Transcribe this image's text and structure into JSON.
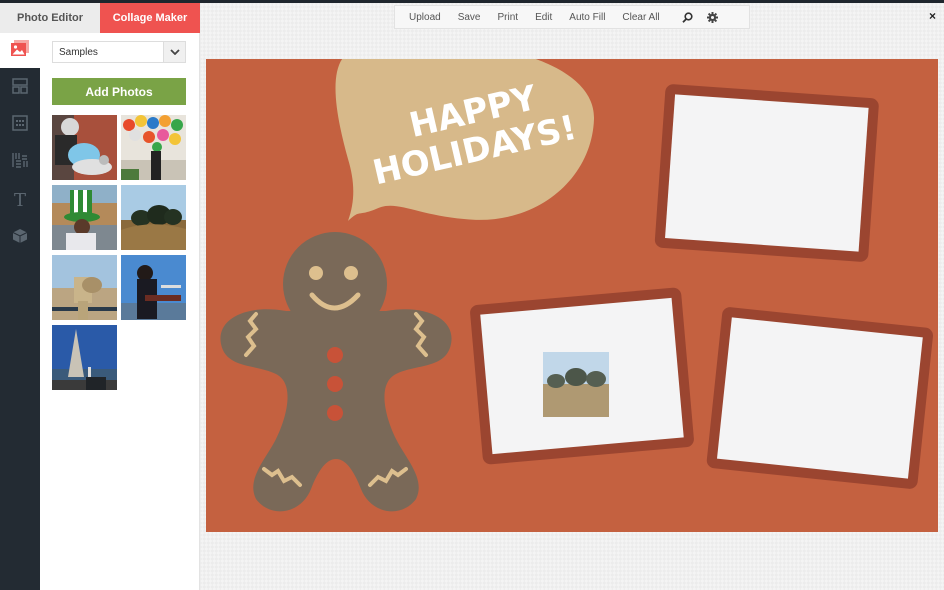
{
  "tabs": [
    {
      "label": "Photo Editor",
      "active": false
    },
    {
      "label": "Collage Maker",
      "active": true
    }
  ],
  "rail": {
    "items": [
      {
        "name": "photos",
        "icon": "image-icon",
        "active": true
      },
      {
        "name": "layouts",
        "icon": "layout-icon",
        "active": false
      },
      {
        "name": "grid",
        "icon": "grid-icon",
        "active": false
      },
      {
        "name": "backgrounds",
        "icon": "pattern-icon",
        "active": false
      },
      {
        "name": "text",
        "icon": "text-icon",
        "active": false
      },
      {
        "name": "stickers",
        "icon": "cube-icon",
        "active": false
      }
    ]
  },
  "panel": {
    "source_select": {
      "value": "Samples"
    },
    "add_photos_label": "Add Photos",
    "thumbnails": [
      {
        "subject": "scooter rider"
      },
      {
        "subject": "balloons woman"
      },
      {
        "subject": "green hat man"
      },
      {
        "subject": "trees on hill"
      },
      {
        "subject": "binocular viewer"
      },
      {
        "subject": "musician on pier"
      },
      {
        "subject": "transamerica tower"
      }
    ]
  },
  "toolbar": {
    "items": [
      "Upload",
      "Save",
      "Print",
      "Edit",
      "Auto Fill",
      "Clear All"
    ],
    "search_icon": "search-icon",
    "settings_icon": "gear-icon"
  },
  "close_label": "×",
  "canvas": {
    "bubble_text": [
      "HAPPY",
      "HOLIDAYS!"
    ],
    "colors": {
      "background": "#c46140",
      "bubble": "#d7b98a",
      "frame": "#9b4530",
      "frame_inner": "#f4f4f5",
      "gingerbread": "#7a6958",
      "icing": "#ddbf8e",
      "buttons": "#c85238"
    },
    "frames": [
      {
        "name": "frame-top-right",
        "photo": null
      },
      {
        "name": "frame-middle",
        "photo": "trees on hill"
      },
      {
        "name": "frame-bottom-right",
        "photo": null
      }
    ]
  },
  "colors": {
    "accent": "#ef5350",
    "add_button": "#7aa346",
    "rail": "#232b33"
  }
}
